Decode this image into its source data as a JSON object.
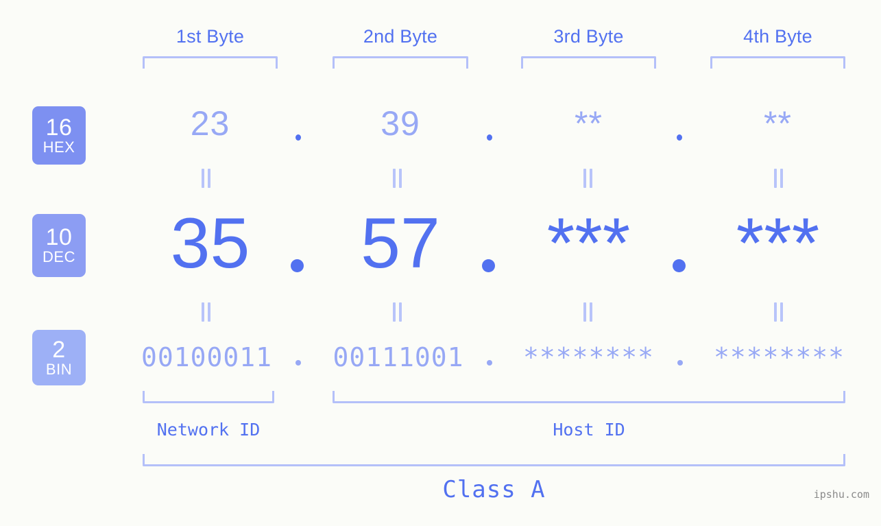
{
  "page": {
    "background_color": "#fbfcf8",
    "accent_color": "#5271f0",
    "accent_light_color": "#97a8f5",
    "accent_lighter_color": "#b4c0f9",
    "watermark": "ipshu.com"
  },
  "byte_headers": [
    {
      "label": "1st Byte"
    },
    {
      "label": "2nd Byte"
    },
    {
      "label": "3rd Byte"
    },
    {
      "label": "4th Byte"
    }
  ],
  "bases": [
    {
      "number": "16",
      "name": "HEX",
      "color": "#7d90f1"
    },
    {
      "number": "10",
      "name": "DEC",
      "color": "#8c9df3"
    },
    {
      "number": "2",
      "name": "BIN",
      "color": "#9db0f6"
    }
  ],
  "rows": {
    "hex": {
      "values": [
        "23",
        "39",
        "**",
        "**"
      ]
    },
    "dec": {
      "values": [
        "35",
        "57",
        "***",
        "***"
      ]
    },
    "bin": {
      "values": [
        "00100011",
        "00111001",
        "********",
        "********"
      ]
    }
  },
  "separators": {
    "octet_dot": ".",
    "equals_mark": "||"
  },
  "id_sections": [
    {
      "label": "Network ID"
    },
    {
      "label": "Host ID"
    }
  ],
  "class_label": "Class A"
}
